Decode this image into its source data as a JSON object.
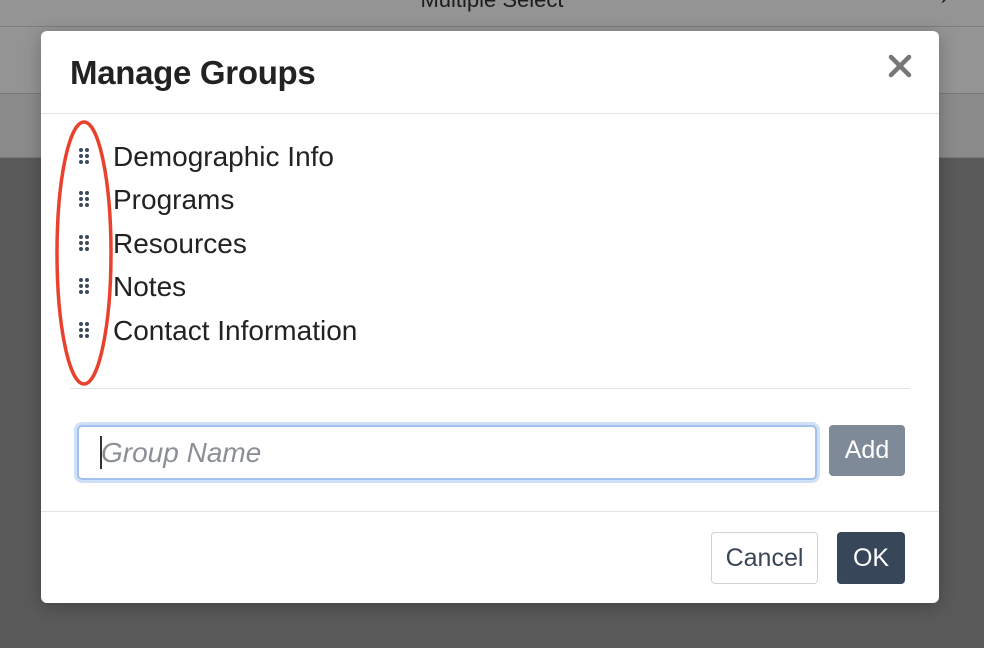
{
  "background": {
    "header_title": "Multiple Select",
    "header_chevron": "›"
  },
  "modal": {
    "title": "Manage Groups",
    "close_icon": "close-icon",
    "groups": [
      {
        "label": "Demographic Info"
      },
      {
        "label": "Programs"
      },
      {
        "label": "Resources"
      },
      {
        "label": "Notes"
      },
      {
        "label": "Contact Information"
      }
    ],
    "drag_icon": "drag-handle-icon",
    "annotation_color": "#e8412c",
    "input": {
      "value": "",
      "placeholder": "Group Name"
    },
    "add_label": "Add",
    "cancel_label": "Cancel",
    "ok_label": "OK"
  },
  "colors": {
    "ok_button": "#384659",
    "add_button": "#7f8a99",
    "input_focus": "#a3c3ee"
  }
}
